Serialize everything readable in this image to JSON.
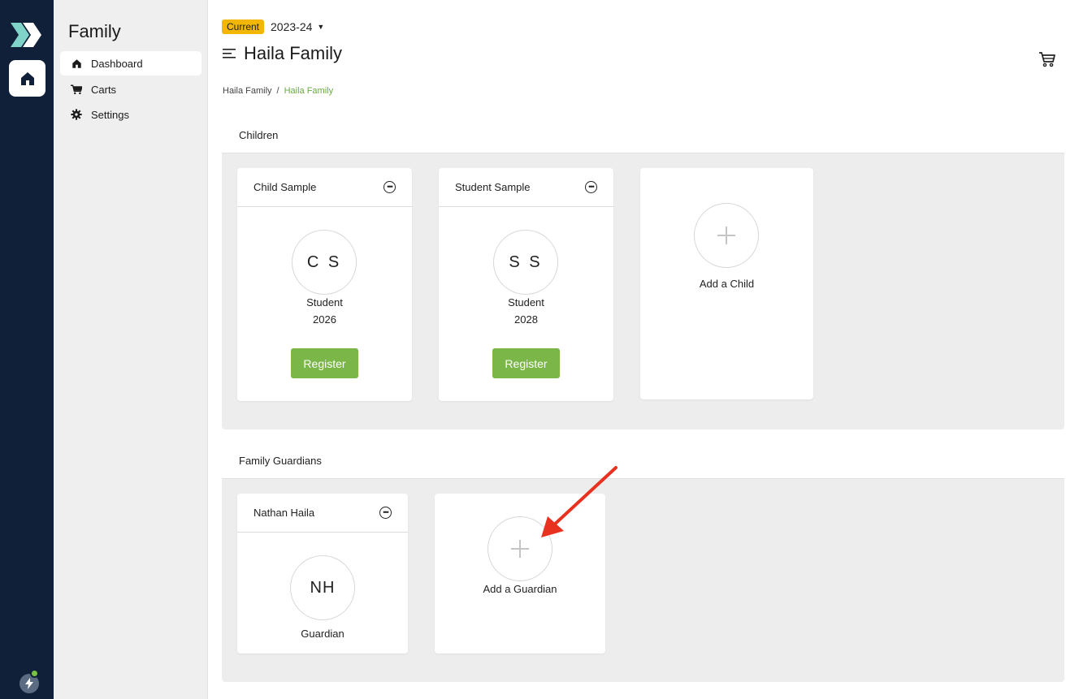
{
  "sidebar": {
    "title": "Family",
    "items": [
      {
        "label": "Dashboard",
        "active": true,
        "icon": "home-icon"
      },
      {
        "label": "Carts",
        "active": false,
        "icon": "cart-icon"
      },
      {
        "label": "Settings",
        "active": false,
        "icon": "gear-icon"
      }
    ]
  },
  "header": {
    "badge": "Current",
    "year": "2023-24",
    "title": "Haila Family"
  },
  "breadcrumb": [
    "Haila Family",
    "Haila Family"
  ],
  "children_section": {
    "title": "Children",
    "cards": [
      {
        "name": "Child Sample",
        "initials": "C S",
        "role": "Student",
        "year": "2026",
        "button": "Register"
      },
      {
        "name": "Student Sample",
        "initials": "S S",
        "role": "Student",
        "year": "2028",
        "button": "Register"
      }
    ],
    "add_label": "Add a Child"
  },
  "guardians_section": {
    "title": "Family Guardians",
    "cards": [
      {
        "name": "Nathan Haila",
        "initials": "NH",
        "role": "Guardian"
      }
    ],
    "add_label": "Add a Guardian"
  },
  "colors": {
    "rail": "#0f2038",
    "accent_green": "#7ab648",
    "badge_yellow": "#f2b705",
    "annotation_arrow": "#e8321f"
  }
}
